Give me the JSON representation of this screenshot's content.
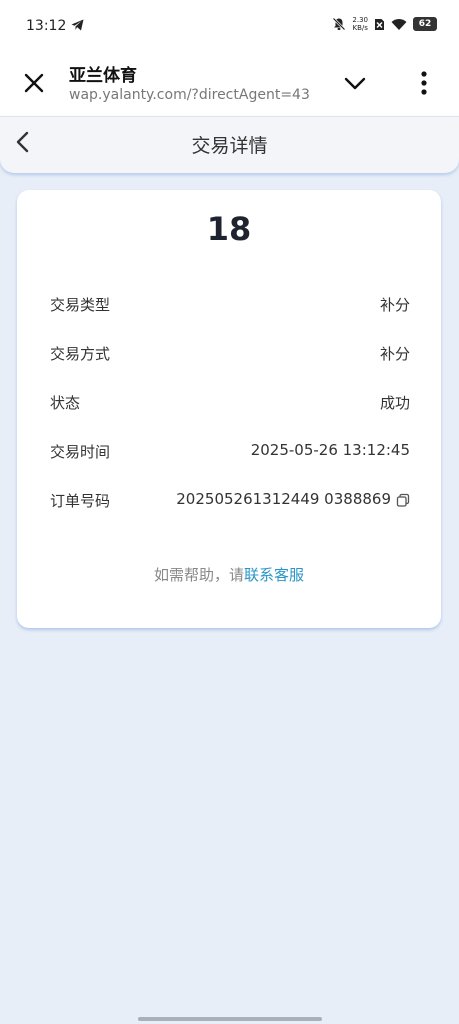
{
  "status_bar": {
    "time": "13:12",
    "net_speed_value": "2.30",
    "net_speed_unit": "KB/s",
    "battery": "62"
  },
  "browser": {
    "site_title": "亚兰体育",
    "url": "wap.yalanty.com/?directAgent=43"
  },
  "header": {
    "title": "交易详情"
  },
  "transaction": {
    "amount": "18",
    "rows": [
      {
        "label": "交易类型",
        "value": "补分"
      },
      {
        "label": "交易方式",
        "value": "补分"
      },
      {
        "label": "状态",
        "value": "成功"
      },
      {
        "label": "交易时间",
        "value": "2025-05-26 13:12:45"
      },
      {
        "label": "订单号码",
        "value": "202505261312449 0388869"
      }
    ]
  },
  "help": {
    "prefix": "如需帮助，请",
    "link": "联系客服"
  },
  "colors": {
    "page_bg": "#e8eef8",
    "link": "#2a96c7",
    "accent_shadow": "#5a8cd2"
  }
}
